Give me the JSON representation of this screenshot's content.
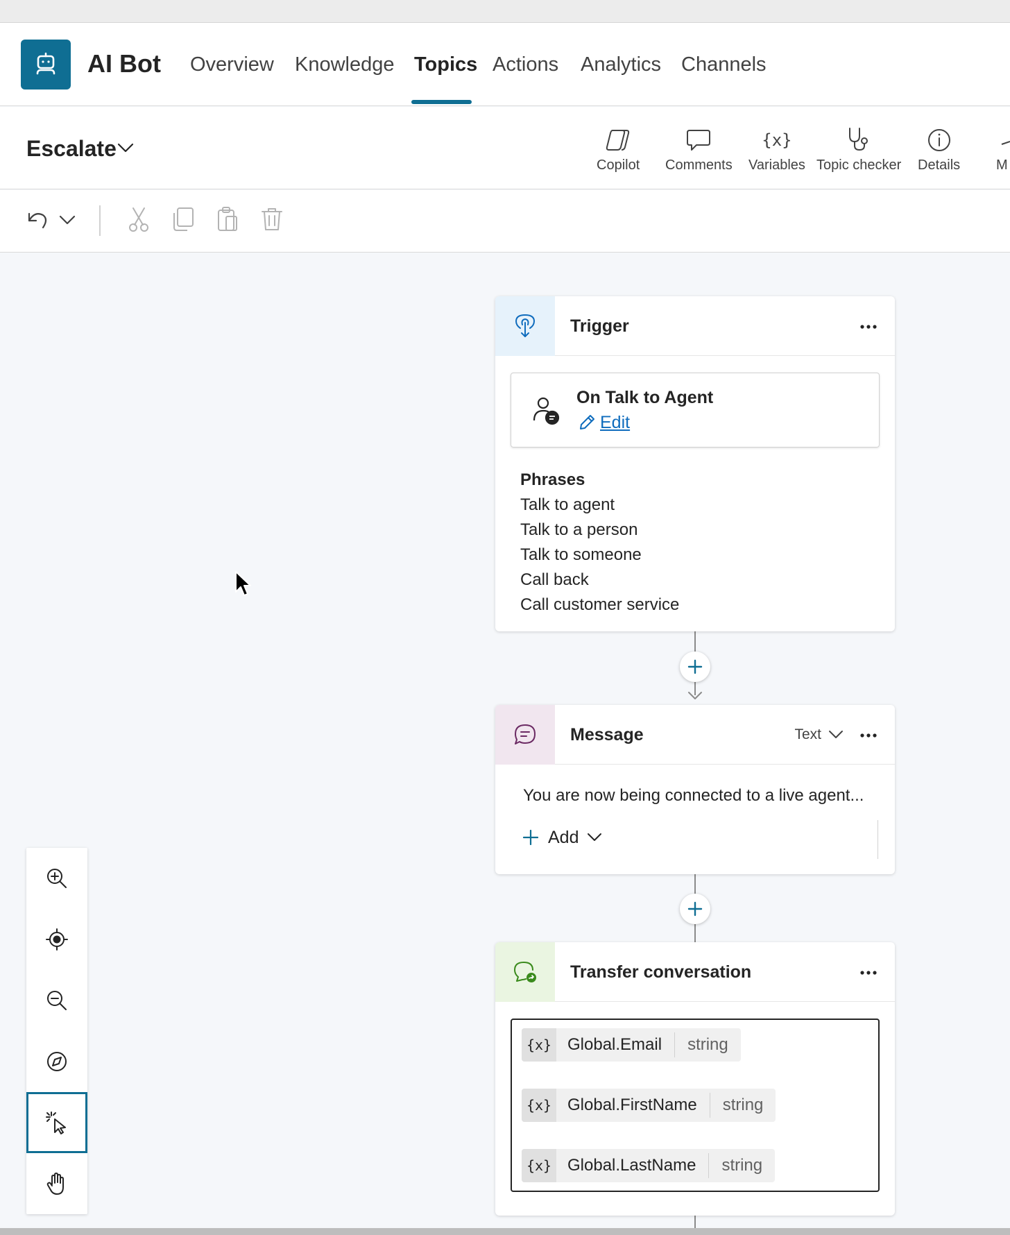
{
  "app": {
    "title": "AI Bot"
  },
  "nav": {
    "tabs": [
      {
        "label": "Overview"
      },
      {
        "label": "Knowledge"
      },
      {
        "label": "Topics",
        "active": true
      },
      {
        "label": "Actions"
      },
      {
        "label": "Analytics"
      },
      {
        "label": "Channels"
      }
    ]
  },
  "topic": {
    "name": "Escalate"
  },
  "toolbar": {
    "copilot_label": "Copilot",
    "comments_label": "Comments",
    "variables_label": "Variables",
    "variables_glyph": "{x}",
    "topic_checker_label": "Topic checker",
    "details_label": "Details",
    "more_label": "M"
  },
  "trigger": {
    "title": "Trigger",
    "name": "On Talk to Agent",
    "edit_label": "Edit",
    "phrases_heading": "Phrases",
    "phrases": [
      "Talk to agent",
      "Talk to a person",
      "Talk to someone",
      "Call back",
      "Call customer service"
    ]
  },
  "message": {
    "title": "Message",
    "type_label": "Text",
    "text": "You are now being connected to a live agent...",
    "add_label": "Add"
  },
  "transfer": {
    "title": "Transfer conversation",
    "variables": [
      {
        "glyph": "{x}",
        "name": "Global.Email",
        "type": "string"
      },
      {
        "glyph": "{x}",
        "name": "Global.FirstName",
        "type": "string"
      },
      {
        "glyph": "{x}",
        "name": "Global.LastName",
        "type": "string"
      }
    ]
  },
  "colors": {
    "accent": "#0f6e93",
    "link": "#0f6cbd",
    "trigger_icon_bg": "#e6f2fb",
    "message_icon_bg": "#f1e6ef",
    "transfer_icon_bg": "#eaf5e1"
  },
  "icons": {
    "zoom_panel": [
      "zoom-in-icon",
      "recenter-icon",
      "zoom-out-icon",
      "minimap-icon",
      "select-icon",
      "pan-hand-icon"
    ],
    "edit_toolbar": [
      "undo-icon",
      "chevron-down-icon",
      "cut-icon",
      "copy-icon",
      "paste-icon",
      "delete-icon"
    ]
  }
}
